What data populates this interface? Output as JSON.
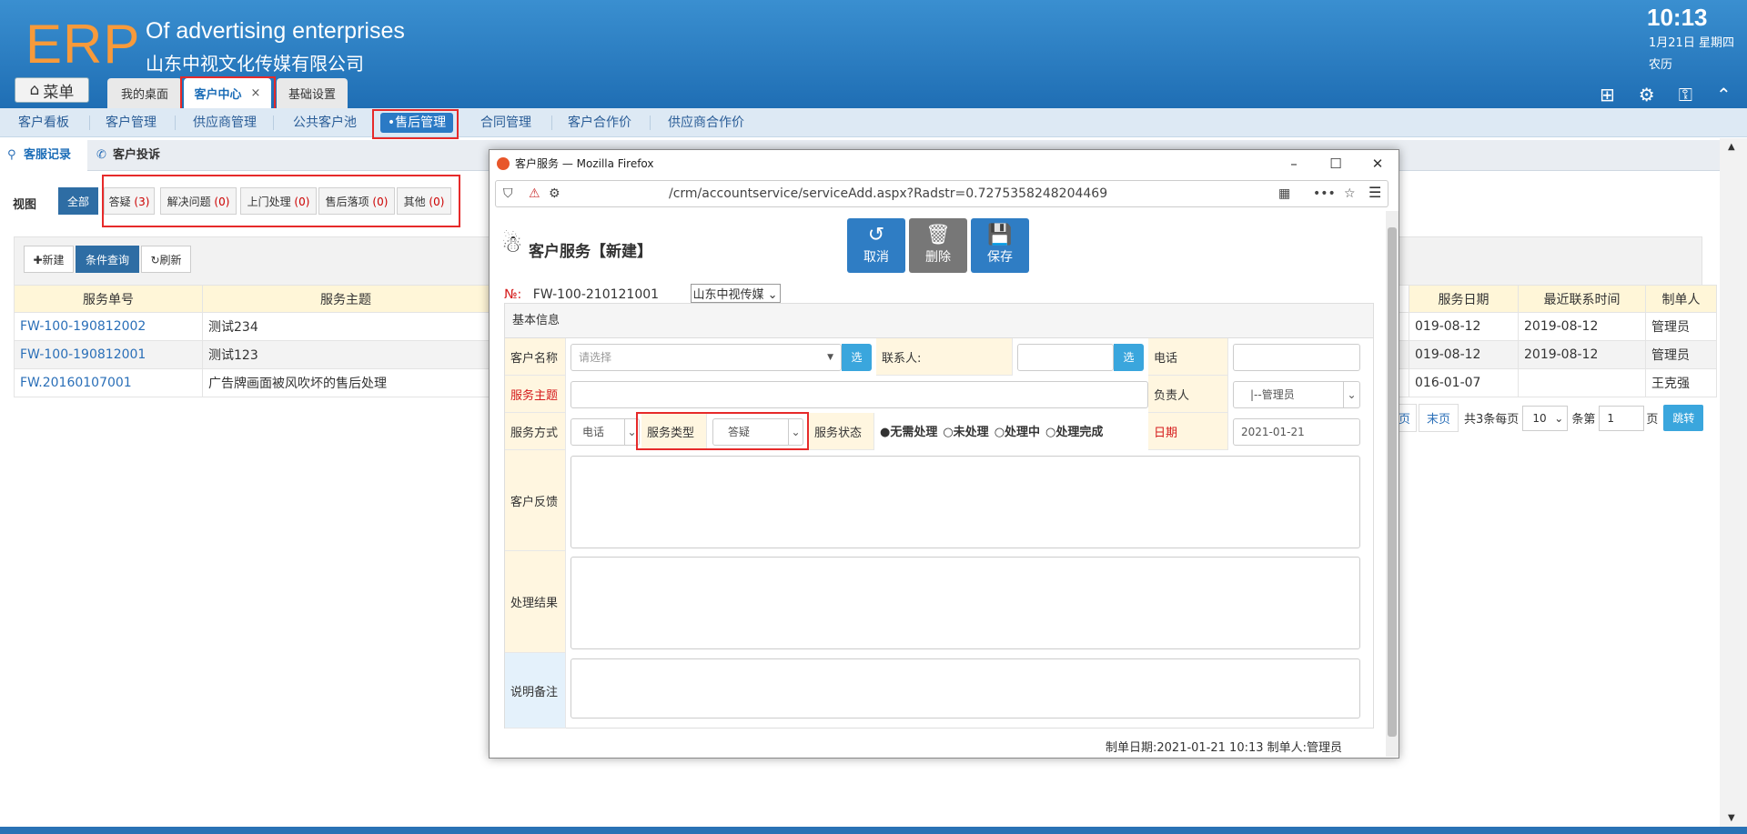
{
  "header": {
    "logo": "ERP",
    "company_en": "Of advertising enterprises",
    "company_cn": "山东中视文化传媒有限公司",
    "time": "10:13",
    "date": "1月21日 星期四",
    "lunar": "农历",
    "menu_label": "菜单",
    "tabs": [
      "我的桌面",
      "客户中心",
      "基础设置"
    ],
    "tab_close": "×"
  },
  "nav": {
    "items": [
      "客户看板",
      "客户管理",
      "供应商管理",
      "公共客户池",
      "•售后管理",
      "合同管理",
      "客户合作价",
      "供应商合作价"
    ]
  },
  "sub_tabs": [
    "客服记录",
    "客户投诉"
  ],
  "view": {
    "label": "视图",
    "filters": [
      {
        "label": "全部",
        "count": ""
      },
      {
        "label": "答疑",
        "count": "(3)"
      },
      {
        "label": "解决问题",
        "count": "(0)"
      },
      {
        "label": "上门处理",
        "count": "(0)"
      },
      {
        "label": "售后落项",
        "count": "(0)"
      },
      {
        "label": "其他",
        "count": "(0)"
      }
    ]
  },
  "toolbar": {
    "new": "✚新建",
    "query": "条件查询",
    "refresh": "↻刷新"
  },
  "table": {
    "columns": [
      "服务单号",
      "服务主题",
      "服务日期",
      "最近联系时间",
      "制单人"
    ],
    "rows": [
      {
        "no": "FW-100-190812002",
        "subject": "测试234",
        "date": "019-08-12",
        "last": "2019-08-12",
        "maker": "管理员"
      },
      {
        "no": "FW-100-190812001",
        "subject": "测试123",
        "date": "019-08-12",
        "last": "2019-08-12",
        "maker": "管理员"
      },
      {
        "no": "FW.20160107001",
        "subject": "广告牌画面被风吹坏的售后处理",
        "date": "016-01-07",
        "last": "",
        "maker": "王克强"
      }
    ]
  },
  "pager": {
    "prev": "页",
    "last": "末页",
    "total": "共3条每页",
    "size": "10",
    "unit": "条第",
    "page": "1",
    "page_unit": "页",
    "go": "跳转"
  },
  "dialog": {
    "title": "客户服务 — Mozilla Firefox",
    "url": "/crm/accountservice/serviceAdd.aspx?Radstr=0.7275358248204469",
    "form_title": "客户服务【新建】",
    "buttons": {
      "cancel": "取消",
      "delete": "删除",
      "save": "保存"
    },
    "no_label": "№:",
    "no_value": "FW-100-210121001",
    "company": "山东中视传媒",
    "section_title": "基本信息",
    "fields": {
      "customer_label": "客户名称",
      "customer_placeholder": "请选择",
      "select_btn": "选",
      "contact_label": "联系人:",
      "phone_label": "电话",
      "subject_label": "服务主题",
      "owner_label": "负责人",
      "owner_value": "|--管理员",
      "method_label": "服务方式",
      "method_value": "电话",
      "type_label": "服务类型",
      "type_value": "答疑",
      "status_label": "服务状态",
      "status_options": [
        "●无需处理",
        "○未处理",
        "○处理中",
        "○处理完成"
      ],
      "date_label": "日期",
      "date_value": "2021-01-21",
      "feedback_label": "客户反馈",
      "result_label": "处理结果",
      "remark_label": "说明备注"
    },
    "footer": "制单日期:2021-01-21 10:13 制单人:管理员"
  }
}
